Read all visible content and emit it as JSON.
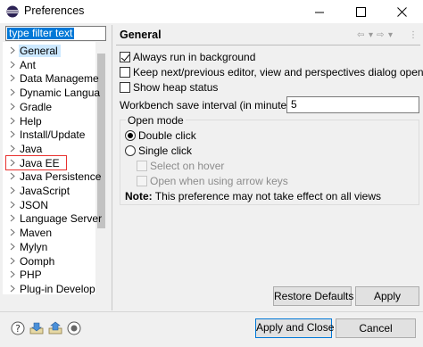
{
  "window": {
    "title": "Preferences",
    "icon": "eclipse-icon",
    "controls": [
      "minimize-icon",
      "maximize-icon",
      "close-icon"
    ]
  },
  "filter": {
    "value": "type filter text"
  },
  "tree": {
    "items": [
      {
        "label": "General",
        "selected": true
      },
      {
        "label": "Ant"
      },
      {
        "label": "Data Manageme"
      },
      {
        "label": "Dynamic Langua"
      },
      {
        "label": "Gradle"
      },
      {
        "label": "Help"
      },
      {
        "label": "Install/Update"
      },
      {
        "label": "Java"
      },
      {
        "label": "Java EE",
        "highlighted": true
      },
      {
        "label": "Java Persistence"
      },
      {
        "label": "JavaScript"
      },
      {
        "label": "JSON"
      },
      {
        "label": "Language Server"
      },
      {
        "label": "Maven"
      },
      {
        "label": "Mylyn"
      },
      {
        "label": "Oomph"
      },
      {
        "label": "PHP"
      },
      {
        "label": "Plug-in Develop"
      }
    ],
    "highlight_color": "#e8312f"
  },
  "page": {
    "title": "General",
    "nav_icons": [
      "back-arrow-icon",
      "dropdown-icon",
      "forward-arrow-icon",
      "dropdown-icon",
      "view-menu-icon"
    ],
    "options": {
      "run_background": {
        "label": "Always run in background",
        "checked": true
      },
      "keep_next_prev": {
        "label": "Keep next/previous editor, view and perspectives dialog open",
        "checked": false
      },
      "show_heap": {
        "label": "Show heap status",
        "checked": false
      }
    },
    "interval": {
      "label": "Workbench save interval (in minutes):",
      "value": "5"
    },
    "open_mode": {
      "title": "Open mode",
      "double_click": {
        "label": "Double click",
        "selected": true
      },
      "single_click": {
        "label": "Single click",
        "selected": false
      },
      "select_on_hover": {
        "label": "Select on hover",
        "enabled": false
      },
      "open_arrow_keys": {
        "label": "Open when using arrow keys",
        "enabled": false
      }
    },
    "note": {
      "bold": "Note:",
      "text": " This preference may not take effect on all views"
    }
  },
  "buttons": {
    "restore_defaults": "Restore Defaults",
    "apply": "Apply",
    "apply_and_close": "Apply and Close",
    "cancel": "Cancel"
  },
  "bottom_icons": [
    "help-icon",
    "import-icon",
    "export-icon",
    "record-icon"
  ],
  "colors": {
    "accent": "#0078d7",
    "selection": "#cce8ff"
  }
}
